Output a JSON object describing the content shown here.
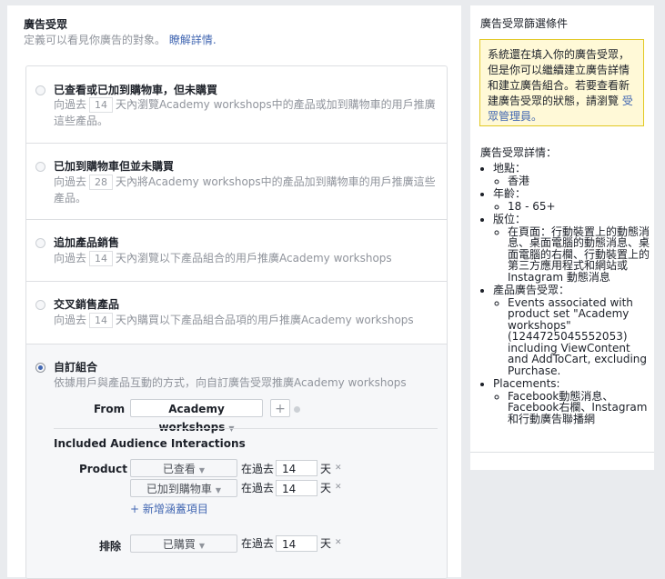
{
  "header": {
    "title": "廣告受眾",
    "subtitle": "定義可以看見你廣告的對象。",
    "learn_more": "瞭解詳情."
  },
  "options": [
    {
      "title": "已查看或已加到購物車，但未購買",
      "pre": "向過去",
      "days": "14",
      "post": "天內瀏覽Academy workshops中的產品或加到購物車的用戶推廣這些產品。"
    },
    {
      "title": "已加到購物車但並未購買",
      "pre": "向過去",
      "days": "28",
      "post": "天內將Academy workshops中的產品加到購物車的用戶推廣這些產品。"
    },
    {
      "title": "追加產品銷售",
      "pre": "向過去",
      "days": "14",
      "post": "天內瀏覽以下產品組合的用戶推廣Academy workshops"
    },
    {
      "title": "交叉銷售產品",
      "pre": "向過去",
      "days": "14",
      "post": "天內購買以下產品組合品項的用戶推廣Academy workshops"
    }
  ],
  "custom": {
    "title": "自訂組合",
    "desc": "依據用戶與產品互動的方式，向自訂廣告受眾推廣Academy workshops",
    "from_label": "From",
    "from_value": "Academy workshops",
    "add_symbol": "+",
    "included_heading": "Included Audience Interactions",
    "product_label": "Product",
    "rules": [
      {
        "event": "已查看",
        "in_past": "在過去",
        "days": "14",
        "unit": "天"
      },
      {
        "event": "已加到購物車",
        "in_past": "在過去",
        "days": "14",
        "unit": "天"
      }
    ],
    "add_more": "+ 新增涵蓋項目",
    "exclude_label": "排除",
    "exclude_rule": {
      "event": "已購買",
      "in_past": "在過去",
      "days": "14",
      "unit": "天"
    }
  },
  "sidebar": {
    "title": "廣告受眾篩選條件",
    "notice_text": "系統還在填入你的廣告受眾，但是你可以繼續建立廣告詳情和建立廣告組合。若要查看新建廣告受眾的狀態，請瀏覽",
    "notice_link": "受眾管理員。",
    "details_title": "廣告受眾詳情：",
    "location_label": "地點：",
    "location_value": "香港",
    "age_label": "年齡：",
    "age_value": "18 - 65+",
    "placement_label": "版位：",
    "placement_value": "在頁面：行動裝置上的動態消息、桌面電腦的動態消息、桌面電腦的右欄、行動裝置上的第三方應用程式和網站或 Instagram 動態消息",
    "product_audience_label": "產品廣告受眾：",
    "product_audience_value": "Events associated with product set \"Academy workshops\" (1244725045552053) including ViewContent and AddToCart, excluding Purchase.",
    "placements_label": "Placements:",
    "placements_value": "Facebook動態消息、Facebook右欄、Instagram和行動廣告聯播網"
  },
  "colors": {
    "accent": "#4267b2",
    "notice_bg": "#fff9d7",
    "notice_border": "#e2c822"
  }
}
